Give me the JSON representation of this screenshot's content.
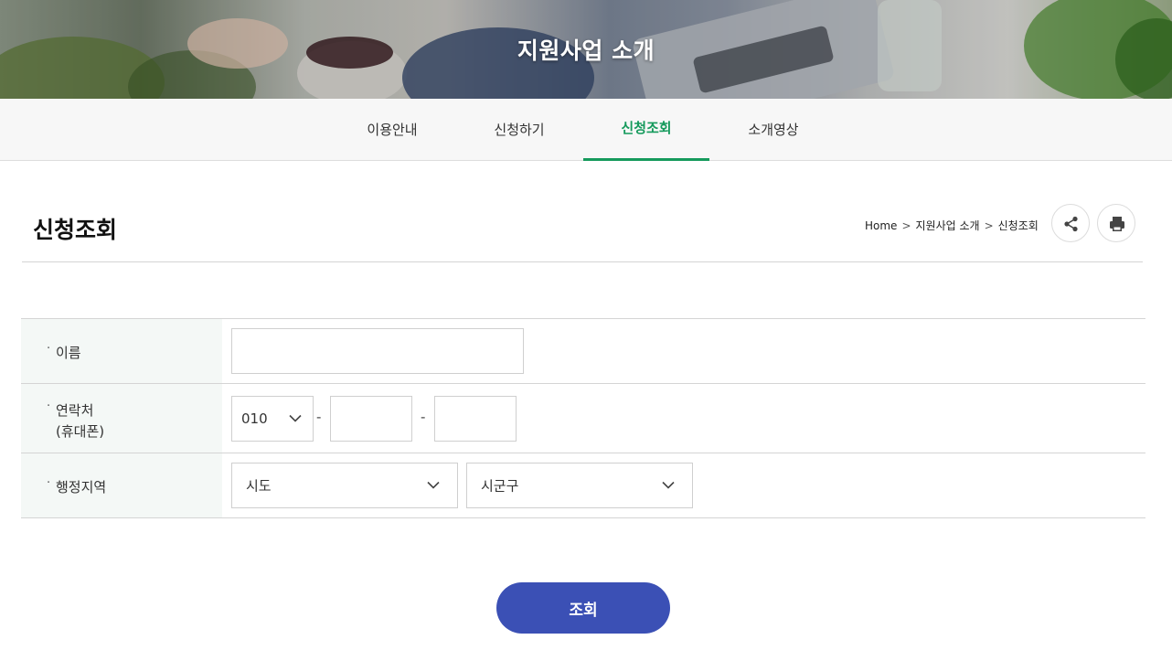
{
  "hero": {
    "title": "지원사업 소개"
  },
  "tabs": [
    {
      "label": "이용안내",
      "active": false
    },
    {
      "label": "신청하기",
      "active": false
    },
    {
      "label": "신청조회",
      "active": true
    },
    {
      "label": "소개영상",
      "active": false
    }
  ],
  "page": {
    "title": "신청조회"
  },
  "breadcrumb": {
    "home": "Home",
    "section": "지원사업 소개",
    "current": "신청조회",
    "separator": ">"
  },
  "actions": {
    "share_icon": "share-icon",
    "print_icon": "print-icon"
  },
  "form": {
    "bullet": "·",
    "name": {
      "label": "이름",
      "value": ""
    },
    "phone": {
      "label_line1": "연락처",
      "label_line2": "(휴대폰)",
      "prefix_selected": "010",
      "middle_value": "",
      "last_value": "",
      "separator": "-"
    },
    "region": {
      "label": "행정지역",
      "sido_selected": "시도",
      "sigungu_selected": "시군구"
    }
  },
  "submit": {
    "label": "조회"
  },
  "colors": {
    "accent_green": "#159a5c",
    "button_blue": "#3b50b5",
    "label_bg": "#f4f8f6"
  }
}
